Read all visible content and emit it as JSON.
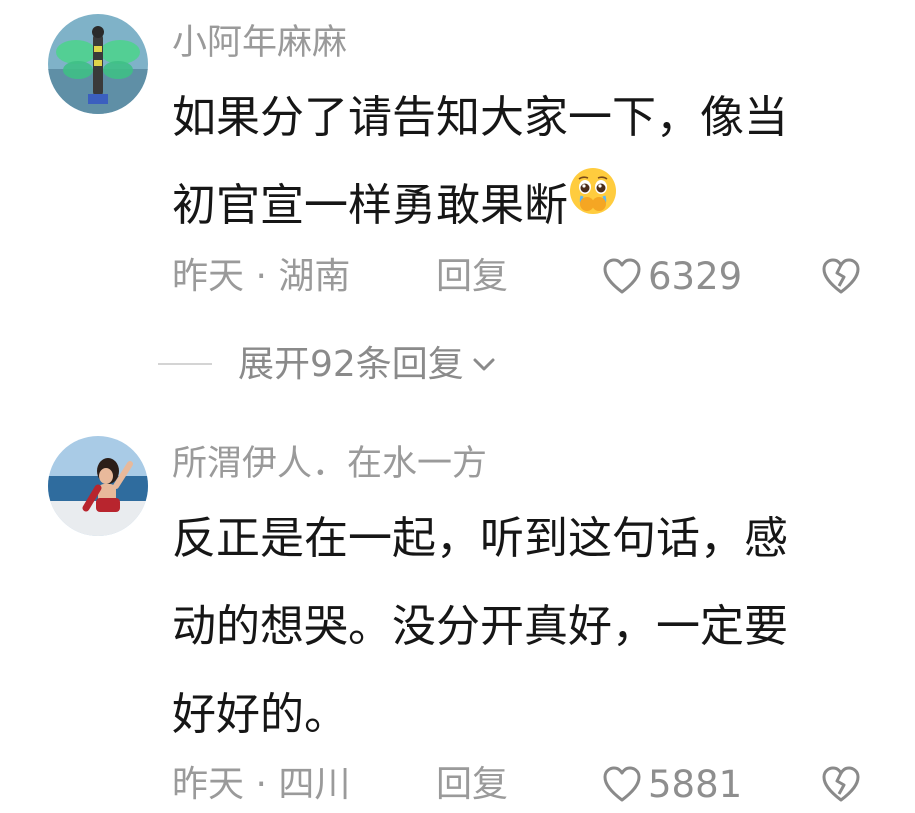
{
  "comments": [
    {
      "username": "小阿年麻麻",
      "text_lines": [
        "如果分了请告知大家一下，像当",
        "初官宣一样勇敢果断"
      ],
      "emoji": "pleading-face-hands-over-mouth-emoji",
      "time": "昨天",
      "separator": "·",
      "location": "湖南",
      "reply_label": "回复",
      "likes": "6329"
    },
    {
      "username": "所渭伊人．在水一方",
      "text_lines": [
        "反正是在一起，听到这句话，感",
        "动的想哭。没分开真好，一定要",
        "好好的。"
      ],
      "time": "昨天",
      "separator": "·",
      "location": "四川",
      "reply_label": "回复",
      "likes": "5881"
    }
  ],
  "expand_replies": {
    "label": "展开92条回复"
  },
  "icons": {
    "like": "heart-outline-icon",
    "dislike": "broken-heart-icon",
    "expand": "chevron-down-icon"
  },
  "colors": {
    "text": "#161616",
    "muted": "#9a9a9a"
  }
}
